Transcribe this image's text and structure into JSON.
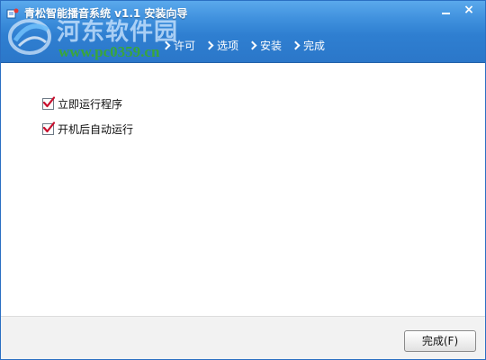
{
  "window": {
    "title": "青松智能播音系统 v1.1 安装向导",
    "minimize_icon": "minimize-icon",
    "close_icon": "close-icon",
    "close_glyph": "×"
  },
  "watermark": {
    "cn_text": "河东软件园",
    "url": "www.pc0359.cn"
  },
  "steps": [
    {
      "label": "许可"
    },
    {
      "label": "选项"
    },
    {
      "label": "安装"
    },
    {
      "label": "完成"
    }
  ],
  "options": [
    {
      "label": "立即运行程序",
      "checked": true
    },
    {
      "label": "开机后自动运行",
      "checked": true
    }
  ],
  "footer": {
    "finish_label": "完成(F)"
  },
  "colors": {
    "header_blue": "#2f7fd1",
    "check_red": "#c8102e",
    "watermark_green": "#3aa63a"
  }
}
